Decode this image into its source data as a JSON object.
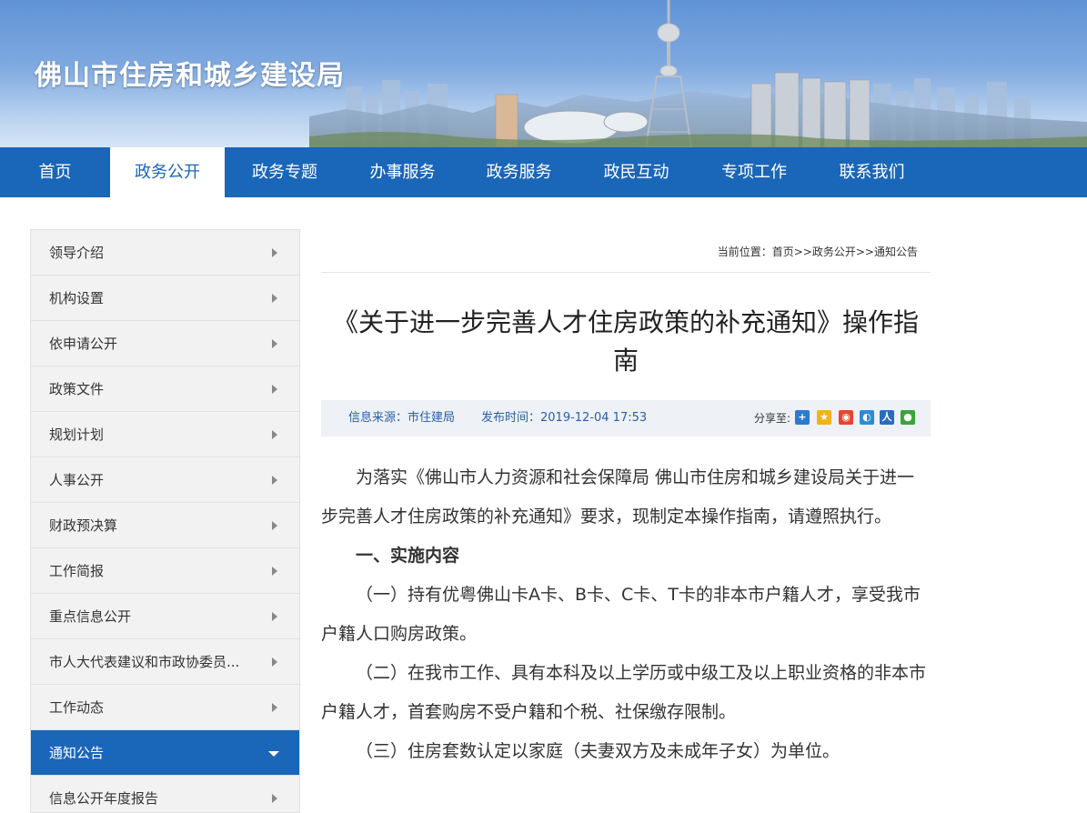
{
  "site": {
    "title": "佛山市住房和城乡建设局"
  },
  "nav": {
    "items": [
      "首页",
      "政务公开",
      "政务专题",
      "办事服务",
      "政务服务",
      "政民互动",
      "专项工作",
      "联系我们"
    ],
    "active_index": 1
  },
  "sidebar": {
    "items": [
      {
        "label": "领导介绍"
      },
      {
        "label": "机构设置"
      },
      {
        "label": "依申请公开"
      },
      {
        "label": "政策文件"
      },
      {
        "label": "规划计划"
      },
      {
        "label": "人事公开"
      },
      {
        "label": "财政预决算"
      },
      {
        "label": "工作简报"
      },
      {
        "label": "重点信息公开"
      },
      {
        "label": "市人大代表建议和市政协委员..."
      },
      {
        "label": "工作动态"
      },
      {
        "label": "通知公告"
      },
      {
        "label": "信息公开年度报告"
      }
    ],
    "active_index": 11
  },
  "breadcrumb": {
    "text": "当前位置：首页>>政务公开>>通知公告"
  },
  "article": {
    "title": "《关于进一步完善人才住房政策的补充通知》操作指南",
    "source": "信息来源：市住建局",
    "published": "发布时间：2019-12-04 17:53",
    "share_label": "分享至:",
    "paragraphs": [
      "为落实《佛山市人力资源和社会保障局 佛山市住房和城乡建设局关于进一步完善人才住房政策的补充通知》要求，现制定本操作指南，请遵照执行。",
      "一、实施内容",
      "（一）持有优粤佛山卡A卡、B卡、C卡、T卡的非本市户籍人才，享受我市户籍人口购房政策。",
      "（二）在我市工作、具有本科及以上学历或中级工及以上职业资格的非本市户籍人才，首套购房不受户籍和个税、社保缴存限制。",
      "（三）住房套数认定以家庭（夫妻双方及未成年子女）为单位。"
    ]
  },
  "colors": {
    "brand": "#1a66b8",
    "meta_bg": "#eef1f5"
  },
  "share_icons": [
    "plus-share-icon",
    "qzone-icon",
    "weibo-icon",
    "tencent-weibo-icon",
    "renren-icon",
    "wechat-icon"
  ]
}
